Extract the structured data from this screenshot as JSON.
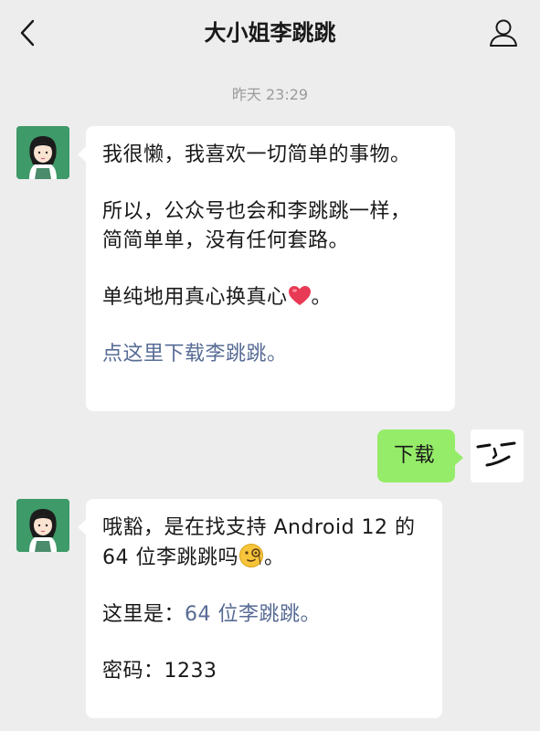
{
  "header": {
    "title": "大小姐李跳跳",
    "back_icon": "chevron-left-icon",
    "profile_icon": "person-icon"
  },
  "timestamp": "昨天 23:29",
  "messages": [
    {
      "from": "contact",
      "lines": [
        "我很懒，我喜欢一切简单的事物。",
        "所以，公众号也会和李跳跳一样，",
        "简简单单，没有任何套路。",
        "单纯地用真心换真心",
        "。"
      ],
      "link": "点这里下载李跳跳。",
      "emoji": "red-heart-icon"
    },
    {
      "from": "me",
      "text": "下载"
    },
    {
      "from": "contact",
      "line1": "哦豁，是在找支持 Android 12 的",
      "line2": "64 位李跳跳吗",
      "line2_end": "。",
      "prefix": "这里是：",
      "link": "64 位李跳跳。",
      "password": "密码：1233",
      "emoji": "monocle-face-icon"
    }
  ],
  "colors": {
    "background": "#ededed",
    "bubble_self": "#95ec69",
    "link": "#576b95"
  }
}
